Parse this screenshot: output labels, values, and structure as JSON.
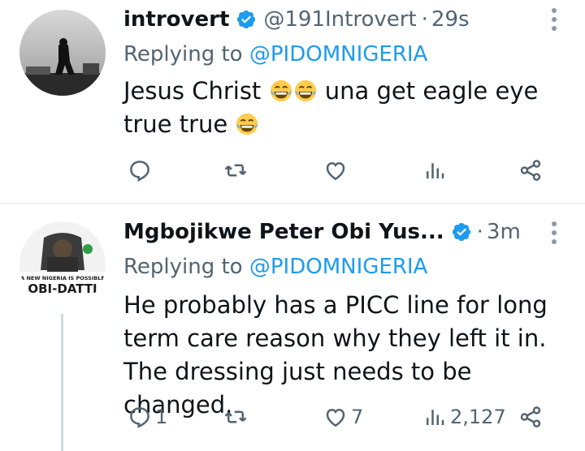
{
  "colors": {
    "link": "#1d9bf0",
    "verified": "#1d9bf0",
    "muted": "#536471",
    "text": "#0f1419"
  },
  "tweets": [
    {
      "display_name": "introvert",
      "handle": "@191Introvert",
      "separator": "·",
      "time": "29s",
      "replying_prefix": "Replying to",
      "replying_to": "@PIDOMNIGERIA",
      "text_1": "Jesus Christ",
      "text_2": "una get eagle eye",
      "text_3": "true true",
      "emoji": "face-with-tears-of-joy",
      "replies": "",
      "retweets": "",
      "likes": "",
      "views": ""
    },
    {
      "display_name": "Mgbojikwe Peter Obi Yus...",
      "separator": "·",
      "time": "3m",
      "replying_prefix": "Replying to",
      "replying_to": "@PIDOMNIGERIA",
      "text": "He probably has a PICC line for long term care reason why they left it in. The dressing just needs to be changed.",
      "avatar_caption": "A NEW NIGERIA IS POSSIBLE",
      "avatar_title": "OBI-DATTI",
      "replies": "1",
      "retweets": "",
      "likes": "7",
      "views": "2,127"
    }
  ],
  "icons": [
    "reply-icon",
    "retweet-icon",
    "like-icon",
    "views-icon",
    "share-icon",
    "verified-badge-icon",
    "more-icon"
  ]
}
